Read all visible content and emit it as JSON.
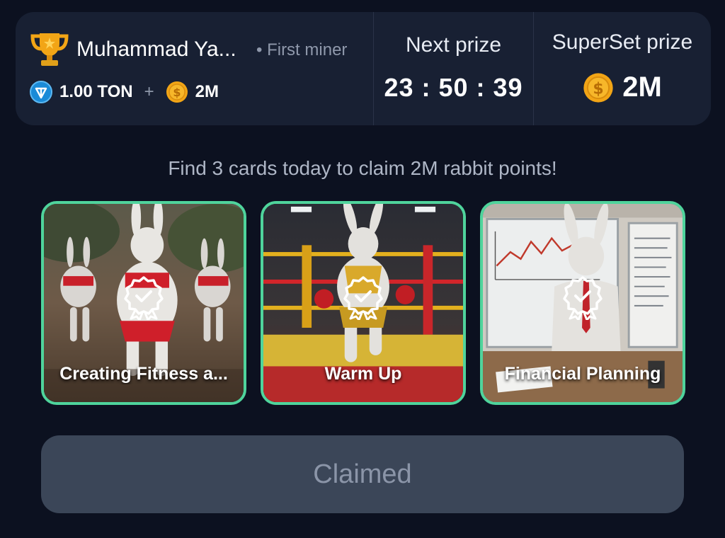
{
  "miner": {
    "name": "Muhammad Ya...",
    "tag": "• First miner",
    "ton_amount": "1.00 TON",
    "plus": "+",
    "coin_amount": "2M"
  },
  "next_prize": {
    "label": "Next prize",
    "timer": "23 : 50 : 39"
  },
  "superset_prize": {
    "label": "SuperSet prize",
    "value": "2M"
  },
  "hint": "Find 3 cards today to claim 2M rabbit points!",
  "cards": [
    {
      "title": "Creating Fitness a..."
    },
    {
      "title": "Warm Up"
    },
    {
      "title": "Financial Planning"
    }
  ],
  "claim_button": {
    "label": "Claimed"
  },
  "colors": {
    "background": "#0c1120",
    "panel": "#182033",
    "card_border": "#4fd49c",
    "button_bg": "#3b4658",
    "button_text": "#8b95a8",
    "gold": "#f2a516"
  },
  "icons": [
    "trophy-icon",
    "ton-icon",
    "coin-icon",
    "badge-check-icon"
  ]
}
